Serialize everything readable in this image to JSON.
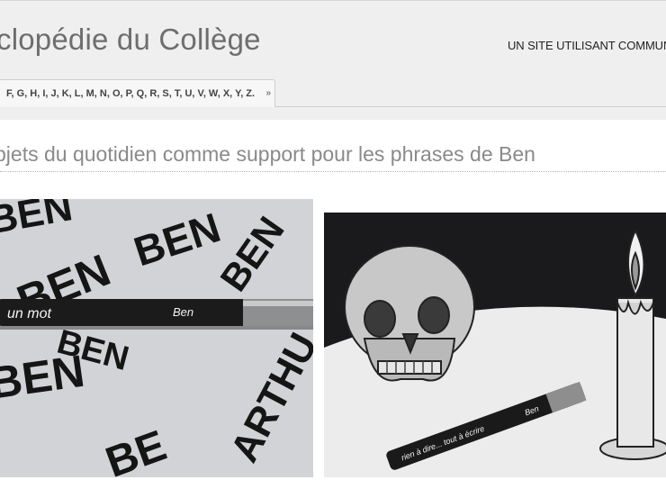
{
  "header": {
    "site_title": "clopédie du Collège",
    "tagline": "UN SITE UTILISANT COMMUNA",
    "alpha_nav": "F, G, H, I, J, K, L, M, N, O, P, Q, R, S, T, U, V, W, X, Y, Z.",
    "alpha_nav_arrow_icon": "double-chevron-down-icon"
  },
  "article": {
    "title": "bjets du quotidien comme support pour les phrases de Ben"
  },
  "images": {
    "photo1": {
      "words": [
        "BEN",
        "BEN",
        "BEN",
        "BEN",
        "BEN",
        "ARTHU",
        "BE",
        "BEN"
      ],
      "pen_text": "un mot",
      "pen_signature": "Ben"
    },
    "photo2": {
      "pen_text": "rien à dire... tout à écrire",
      "pen_signature": "Ben"
    }
  },
  "colors": {
    "header_bg": "#efefef",
    "title_text": "#6e6e6e",
    "article_title": "#8a8a8a"
  }
}
